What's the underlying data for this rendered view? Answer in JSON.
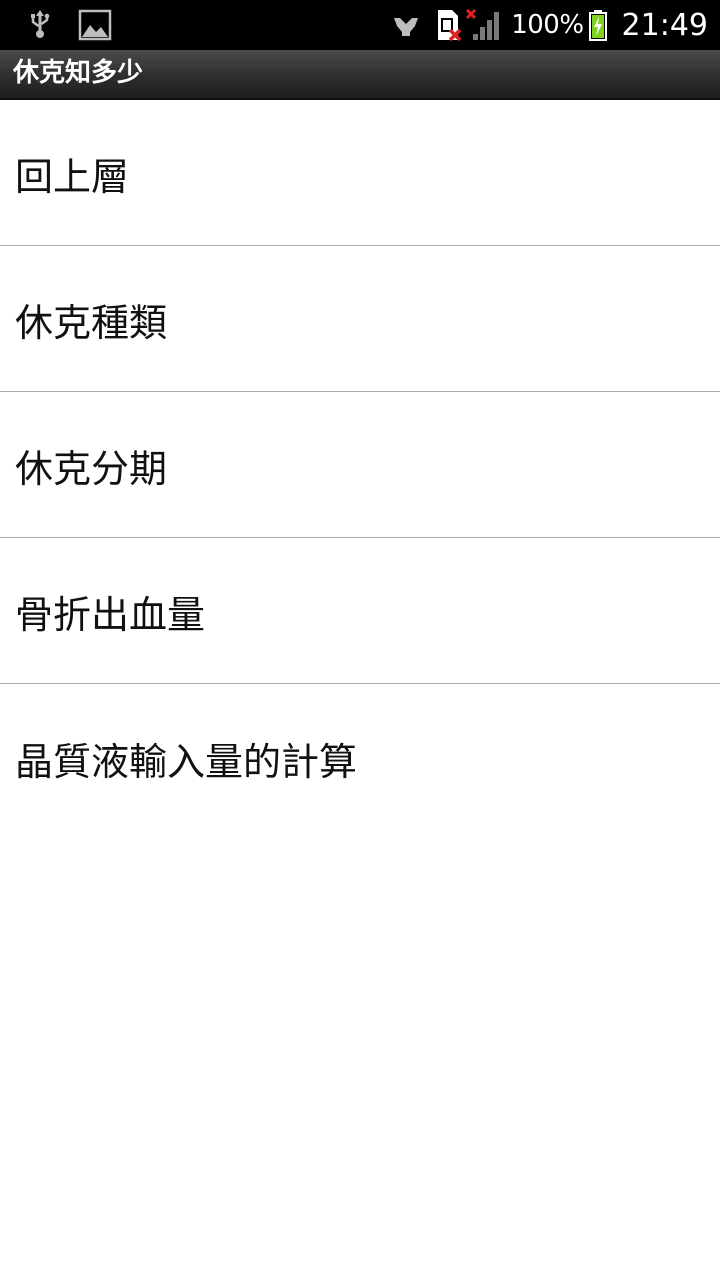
{
  "status_bar": {
    "icons_left": [
      "usb-icon",
      "image-notification-icon"
    ],
    "icons_right": [
      "vibrate-icon",
      "no-sim-icon",
      "signal-no-service-icon",
      "battery-charging-icon"
    ],
    "battery": "100%",
    "time": "21:49"
  },
  "app_bar": {
    "title": "休克知多少"
  },
  "menu": {
    "items": [
      {
        "label": "回上層"
      },
      {
        "label": "休克種類"
      },
      {
        "label": "休克分期"
      },
      {
        "label": "骨折出血量"
      },
      {
        "label": "晶質液輸入量的計算"
      }
    ]
  },
  "colors": {
    "status_bar_bg": "#000000",
    "title_bar_bg": "#2e2e2e",
    "list_bg": "#ffffff",
    "divider": "#a9a9a9",
    "text_primary": "#111111",
    "battery_charge": "#7ed321"
  }
}
